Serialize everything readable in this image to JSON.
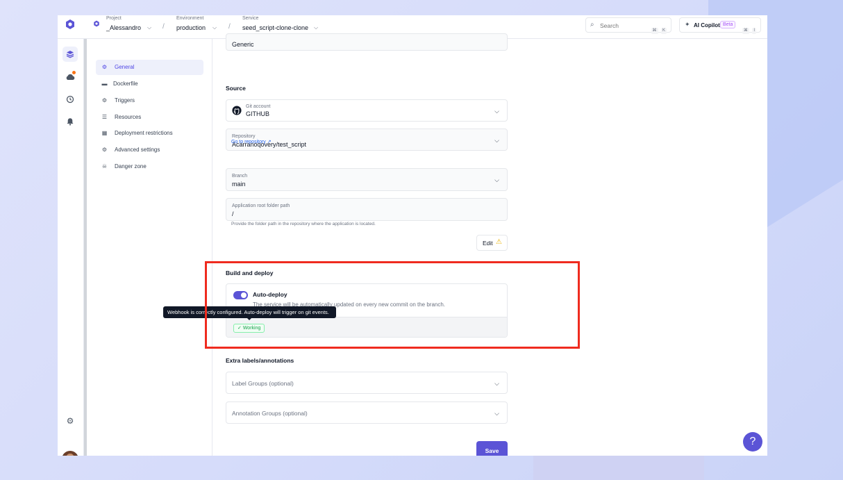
{
  "topbar": {
    "project_label": "Project",
    "project_value": "_Alessandro",
    "environment_label": "Environment",
    "environment_value": "production",
    "service_label": "Service",
    "service_value": "seed_script-clone-clone",
    "search_placeholder": "Search",
    "search_kbd_1": "⌘",
    "search_kbd_2": "K",
    "copilot_label": "AI Copilot",
    "copilot_badge": "Beta",
    "copilot_kbd_1": "⌘",
    "copilot_kbd_2": "I"
  },
  "subnav": {
    "items": [
      {
        "label": "General",
        "icon": "gear-icon"
      },
      {
        "label": "Dockerfile",
        "icon": "file-icon"
      },
      {
        "label": "Triggers",
        "icon": "cogs-icon"
      },
      {
        "label": "Resources",
        "icon": "server-icon"
      },
      {
        "label": "Deployment restrictions",
        "icon": "restriction-icon"
      },
      {
        "label": "Advanced settings",
        "icon": "cogs-icon"
      },
      {
        "label": "Danger zone",
        "icon": "skull-icon"
      }
    ]
  },
  "main": {
    "partial_field_value": "Generic",
    "source_title": "Source",
    "git_account_label": "Git account",
    "git_account_value": "GITHUB",
    "repository_label": "Repository",
    "repository_value": "Acarranoqovery/test_script",
    "goto_repo_link": "Go to repository",
    "branch_label": "Branch",
    "branch_value": "main",
    "root_path_label": "Application root folder path",
    "root_path_value": "/",
    "root_path_hint": "Provide the folder path in the repository where the application is located.",
    "edit_label": "Edit",
    "build_deploy_title": "Build and deploy",
    "autodeploy_title": "Auto-deploy",
    "autodeploy_desc": "The service will be automatically updated on every new commit on the branch.",
    "autodeploy_enabled": true,
    "status_badge": "Working",
    "tooltip_text": "Webhook is correctly configured. Auto-deploy will trigger on git events.",
    "extra_labels_title": "Extra labels/annotations",
    "label_groups_placeholder": "Label Groups (optional)",
    "annotation_groups_placeholder": "Annotation Groups (optional)",
    "save_label": "Save",
    "help_label": "?"
  },
  "colors": {
    "accent": "#5b54d6",
    "highlight_border": "#ef2b1f",
    "success": "#16a34a",
    "warning": "#eab308"
  }
}
